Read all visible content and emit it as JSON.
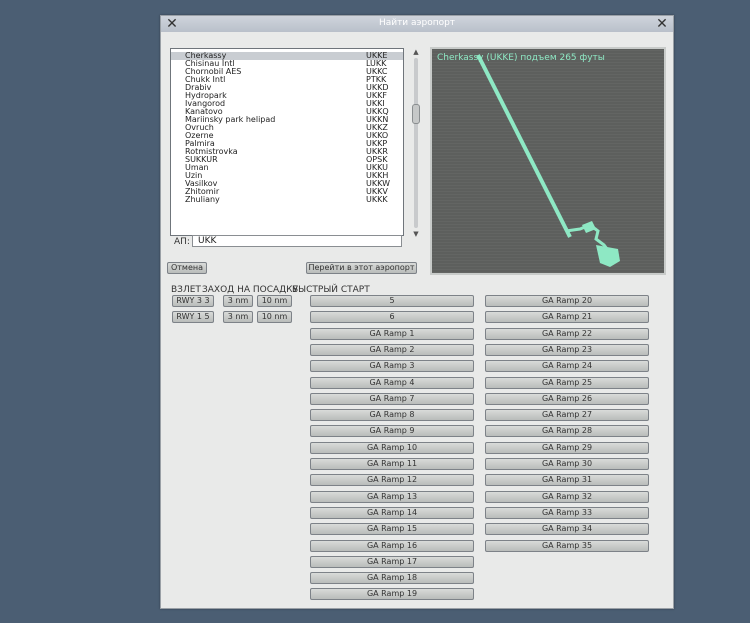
{
  "window": {
    "title": "Найти аэропорт",
    "close_left": "✕",
    "close_right": "✕"
  },
  "airports": [
    {
      "name": "Cherkassy",
      "code": "UKKE"
    },
    {
      "name": "Chisinau Intl",
      "code": "LUKK"
    },
    {
      "name": "Chornobil AES",
      "code": "UKKC"
    },
    {
      "name": "Chukk Intl",
      "code": "PTKK"
    },
    {
      "name": "Drabiv",
      "code": "UKKD"
    },
    {
      "name": "Hydropark",
      "code": "UKKF"
    },
    {
      "name": "Ivangorod",
      "code": "UKKI"
    },
    {
      "name": "Kanatovo",
      "code": "UKKQ"
    },
    {
      "name": "Mariinsky park helipad",
      "code": "UKKN"
    },
    {
      "name": "Ovruch",
      "code": "UKKZ"
    },
    {
      "name": "Ozerne",
      "code": "UKKO"
    },
    {
      "name": "Palmira",
      "code": "UKKP"
    },
    {
      "name": "Rotmistrovka",
      "code": "UKKR"
    },
    {
      "name": "SUKKUR",
      "code": "OPSK"
    },
    {
      "name": "Uman",
      "code": "UKKU"
    },
    {
      "name": "Uzin",
      "code": "UKKH"
    },
    {
      "name": "Vasilkov",
      "code": "UKKW"
    },
    {
      "name": "Zhitomir",
      "code": "UKKV"
    },
    {
      "name": "Zhuliany",
      "code": "UKKK"
    }
  ],
  "selected_index": 0,
  "search": {
    "label": "АП:",
    "value": "UKK"
  },
  "map": {
    "label": "Cherkassy (UKKE) подъем 265 футы",
    "runway_color": "#8ee8c4"
  },
  "buttons": {
    "cancel": "Отмена",
    "goto": "Перейти в этот аэропорт"
  },
  "sections": {
    "takeoff": "ВЗЛЕТ",
    "approach": "ЗАХОД НА ПОСАДКУ",
    "quick": "БЫСТРЫЙ СТАРТ"
  },
  "runways": [
    {
      "label": "RWY 3 3",
      "d1": "3 nm",
      "d2": "10 nm"
    },
    {
      "label": "RWY 1 5",
      "d1": "3 nm",
      "d2": "10 nm"
    }
  ],
  "ramps_col1": [
    "5",
    "6",
    "GA Ramp  1",
    "GA Ramp  2",
    "GA Ramp  3",
    "GA Ramp  4",
    "GA Ramp  7",
    "GA Ramp  8",
    "GA Ramp  9",
    "GA Ramp 10",
    "GA Ramp 11",
    "GA Ramp 12",
    "GA Ramp 13",
    "GA Ramp 14",
    "GA Ramp 15",
    "GA Ramp 16",
    "GA Ramp 17",
    "GA Ramp 18",
    "GA Ramp 19"
  ],
  "ramps_col2": [
    "GA Ramp 20",
    "GA Ramp 21",
    "GA Ramp 22",
    "GA Ramp 23",
    "GA Ramp 24",
    "GA Ramp 25",
    "GA Ramp 26",
    "GA Ramp 27",
    "GA Ramp 28",
    "GA Ramp 29",
    "GA Ramp 30",
    "GA Ramp 31",
    "GA Ramp 32",
    "GA Ramp 33",
    "GA Ramp 34",
    "GA Ramp 35"
  ]
}
